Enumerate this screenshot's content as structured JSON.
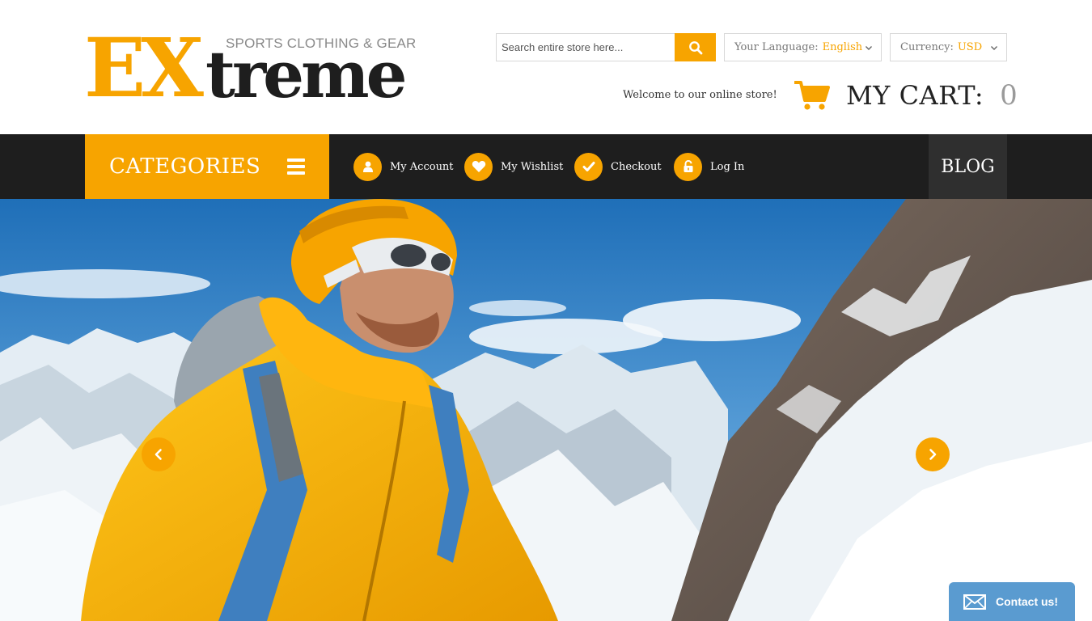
{
  "logo": {
    "part1": "EX",
    "part2": "treme",
    "tagline": "SPORTS CLOTHING & GEAR"
  },
  "search": {
    "placeholder": "Search entire store here...",
    "icon": "search-icon"
  },
  "language": {
    "label": "Your Language:",
    "value": "English"
  },
  "currency": {
    "label": "Currency:",
    "value": "USD"
  },
  "welcome": "Welcome to our online store!",
  "cart": {
    "label": "MY CART:",
    "count": "0",
    "icon": "cart-icon"
  },
  "nav": {
    "categories_label": "CATEGORIES",
    "links": [
      {
        "label": "My Account",
        "icon": "user-icon"
      },
      {
        "label": "My Wishlist",
        "icon": "heart-icon"
      },
      {
        "label": "Checkout",
        "icon": "check-icon"
      },
      {
        "label": "Log In",
        "icon": "unlock-icon"
      }
    ],
    "blog_label": "BLOG"
  },
  "hero": {
    "prev_icon": "chevron-left-icon",
    "next_icon": "chevron-right-icon"
  },
  "contact": {
    "label": "Contact us!",
    "icon": "envelope-icon"
  },
  "colors": {
    "accent": "#f7a400",
    "nav_background": "#1e1e1e",
    "blog_background": "#2f2f2f",
    "contact_background": "#5a9bd0"
  }
}
